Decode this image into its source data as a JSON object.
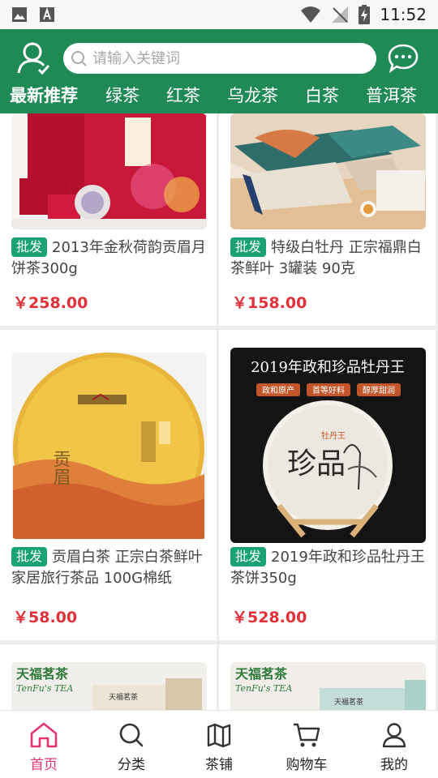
{
  "status_bar": {
    "time": "11:52"
  },
  "header": {
    "search_placeholder": "请输入关键词",
    "tabs": [
      "最新推荐",
      "绿茶",
      "红茶",
      "乌龙茶",
      "白茶",
      "普洱茶"
    ]
  },
  "products": [
    {
      "badge": "批发",
      "title": "2013年金秋荷韵贡眉月饼茶300g",
      "price": "￥258.00"
    },
    {
      "badge": "批发",
      "title": "特级白牡丹 正宗福鼎白茶鲜叶 3罐装 90克",
      "price": "￥158.00"
    },
    {
      "badge": "批发",
      "title": "贡眉白茶 正宗白茶鲜叶 家居旅行茶品 100G棉纸",
      "price": "￥58.00"
    },
    {
      "badge": "批发",
      "title": "2019年政和珍品牡丹王茶饼350g",
      "price": "￥528.00"
    }
  ],
  "product_images": {
    "p3_label": "贡眉",
    "p4_banner": "2019年政和珍品牡丹王",
    "p4_tags": [
      "政和原产",
      "首等好料",
      "醇厚甜润"
    ],
    "p4_cake": "珍品",
    "p4_cake_sub": "牡丹王",
    "brand_cn": "天福茗茶",
    "brand_en": "TenFu's TEA"
  },
  "bottom_nav": [
    {
      "label": "首页",
      "icon": "home-icon"
    },
    {
      "label": "分类",
      "icon": "search-icon"
    },
    {
      "label": "茶铺",
      "icon": "map-icon"
    },
    {
      "label": "购物车",
      "icon": "cart-icon"
    },
    {
      "label": "我的",
      "icon": "user-icon"
    }
  ],
  "colors": {
    "header_green": "#1f8a56",
    "badge_green": "#19a374",
    "price_red": "#e0303a",
    "nav_active": "#e2356b"
  }
}
